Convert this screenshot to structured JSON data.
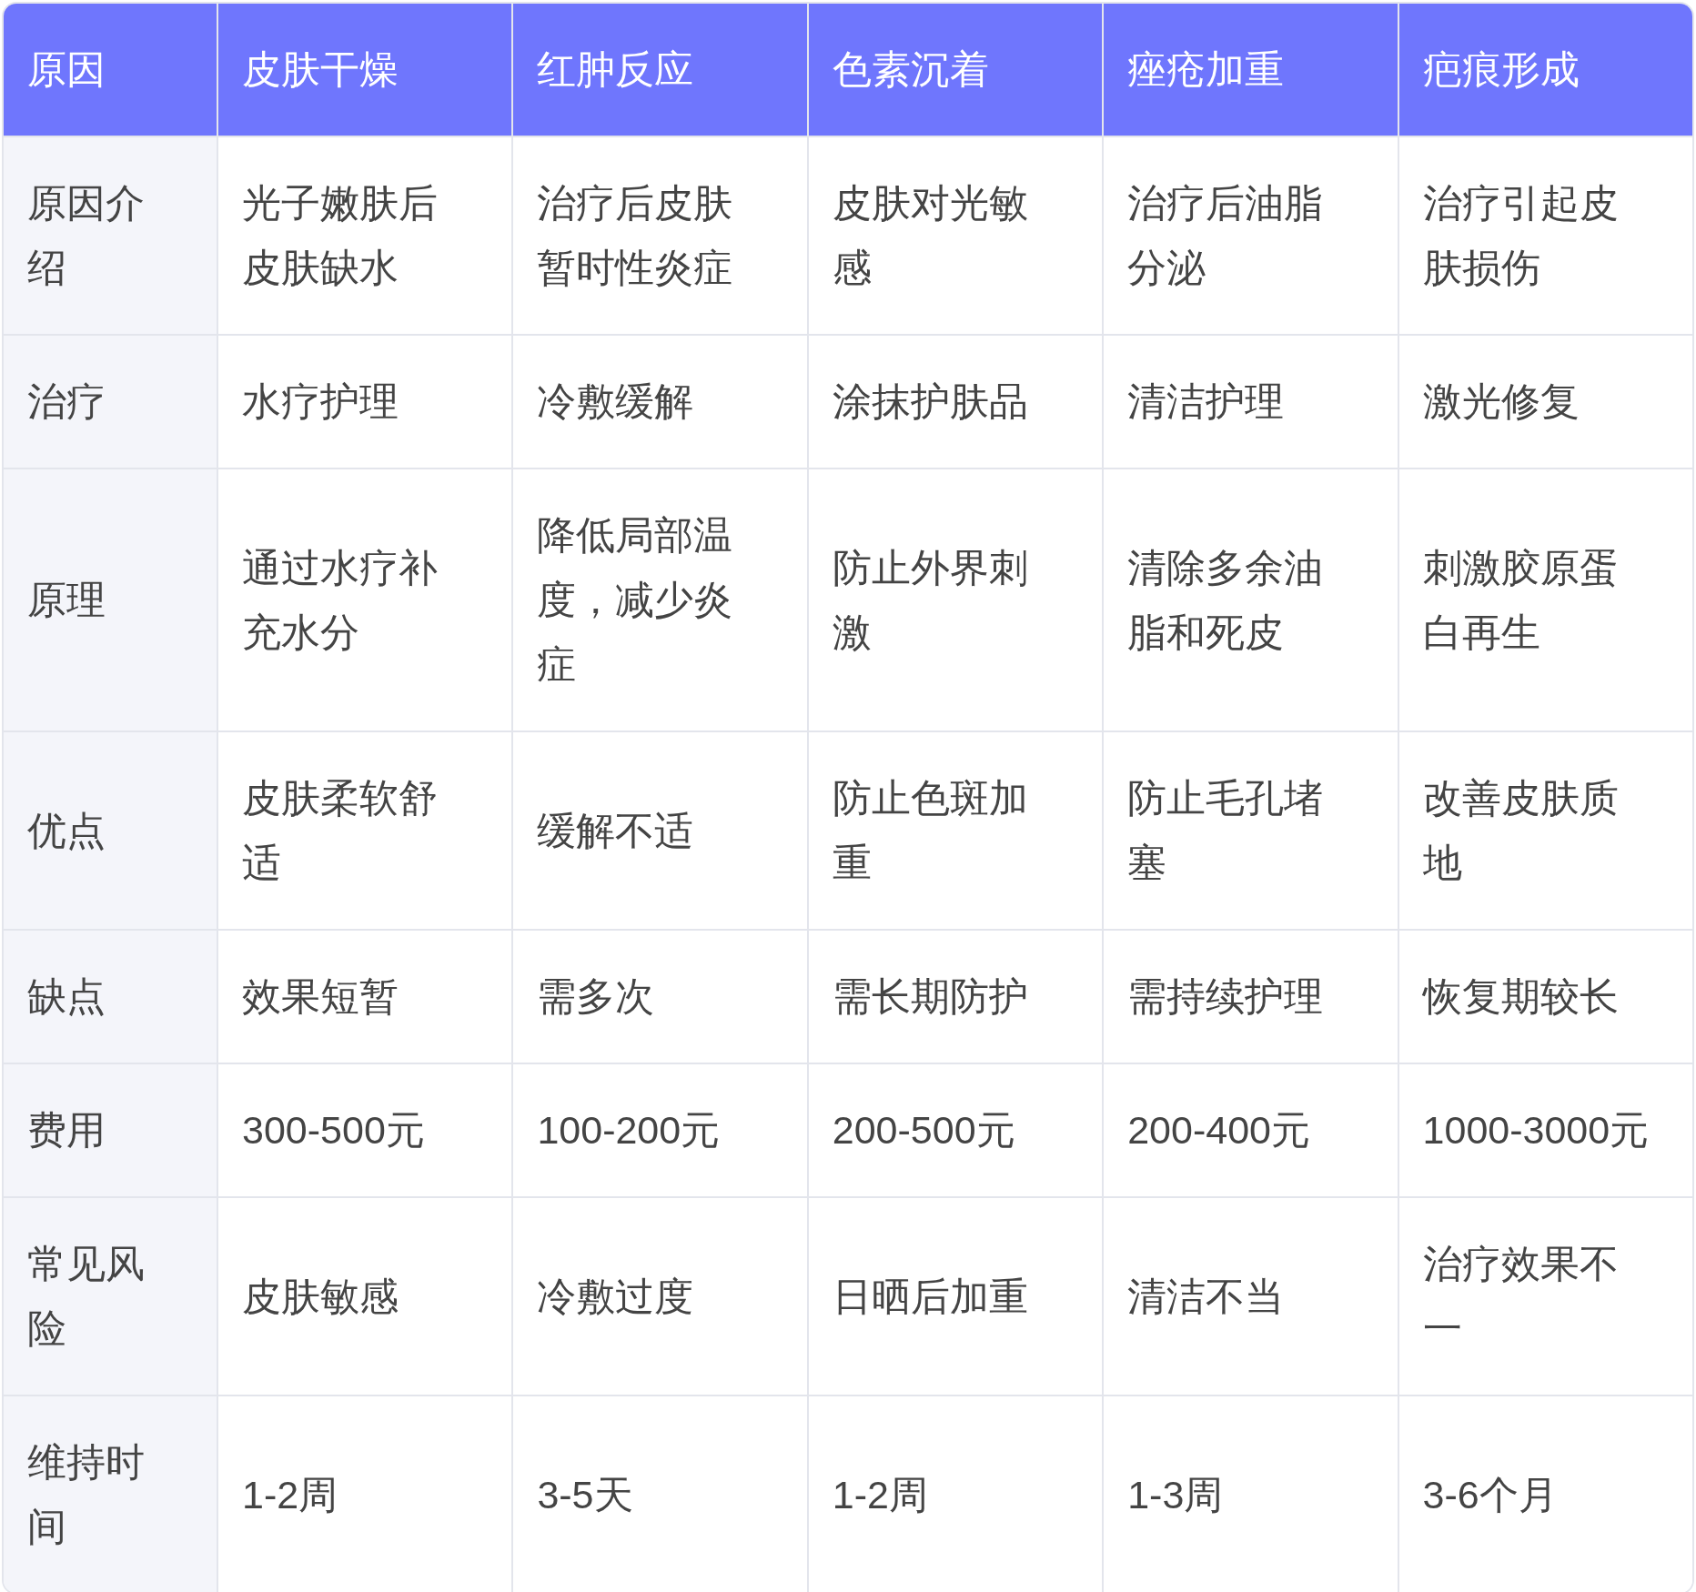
{
  "table": {
    "columns": [
      "原因",
      "皮肤干燥",
      "红肿反应",
      "色素沉着",
      "痤疮加重",
      "疤痕形成"
    ],
    "rows": [
      {
        "cells": [
          "原因介绍",
          "光子嫩肤后皮肤缺水",
          "治疗后皮肤暂时性炎症",
          "皮肤对光敏感",
          "治疗后油脂分泌",
          "治疗引起皮肤损伤"
        ]
      },
      {
        "cells": [
          "治疗",
          "水疗护理",
          "冷敷缓解",
          "涂抹护肤品",
          "清洁护理",
          "激光修复"
        ]
      },
      {
        "cells": [
          "原理",
          "通过水疗补充水分",
          "降低局部温度，减少炎症",
          "防止外界刺激",
          "清除多余油脂和死皮",
          "刺激胶原蛋白再生"
        ]
      },
      {
        "cells": [
          "优点",
          "皮肤柔软舒适",
          "缓解不适",
          "防止色斑加重",
          "防止毛孔堵塞",
          "改善皮肤质地"
        ]
      },
      {
        "cells": [
          "缺点",
          "效果短暂",
          "需多次",
          "需长期防护",
          "需持续护理",
          "恢复期较长"
        ]
      },
      {
        "cells": [
          "费用",
          "300-500元",
          "100-200元",
          "200-500元",
          "200-400元",
          "1000-3000元"
        ]
      },
      {
        "cells": [
          "常见风险",
          "皮肤敏感",
          "冷敷过度",
          "日晒后加重",
          "清洁不当",
          "治疗效果不一"
        ]
      },
      {
        "cells": [
          "维持时间",
          "1-2周",
          "3-5天",
          "1-2周",
          "1-3周",
          "3-6个月"
        ]
      }
    ]
  }
}
